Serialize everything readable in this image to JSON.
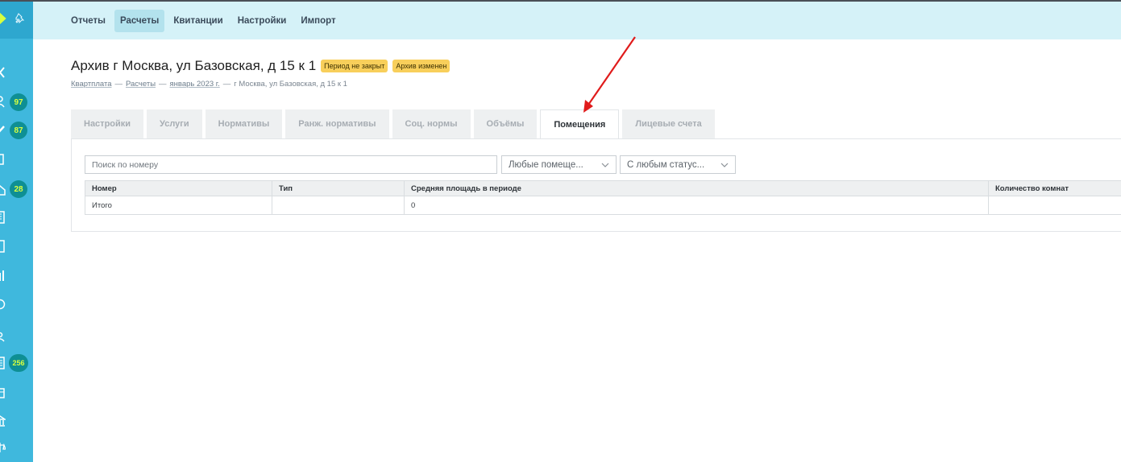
{
  "sidebar": {
    "badges": [
      "97",
      "87",
      "28",
      "256"
    ]
  },
  "nav": {
    "items": [
      "Отчеты",
      "Расчеты",
      "Квитанции",
      "Настройки",
      "Импорт"
    ],
    "active": "Расчеты"
  },
  "header": {
    "title": "Архив г Москва, ул Базовская, д 15 к 1",
    "badges": [
      "Период не закрыт",
      "Архив изменен"
    ],
    "breadcrumb": [
      "Квартплата",
      "Расчеты",
      "январь 2023 г.",
      "г Москва, ул Базовская, д 15 к 1"
    ],
    "separator": "—"
  },
  "tabs": [
    "Настройки",
    "Услуги",
    "Нормативы",
    "Ранж. нормативы",
    "Соц. нормы",
    "Объёмы",
    "Помещения",
    "Лицевые счета"
  ],
  "active_tab": "Помещения",
  "filters": {
    "search_placeholder": "Поиск по номеру",
    "room_select": "Любые помеще...",
    "status_select": "С любым статус..."
  },
  "table": {
    "columns": [
      "Номер",
      "Тип",
      "Средняя площадь в периоде",
      "Количество комнат"
    ],
    "rows": [
      [
        "Итого",
        "",
        "0",
        ""
      ]
    ]
  },
  "colors": {
    "sidebar": "#3fb8dd",
    "topbar": "#d5f2f8",
    "badge_yellow": "#f8cf5b",
    "badge_teal": "#0e8f94",
    "arrow": "#e01b1b"
  }
}
